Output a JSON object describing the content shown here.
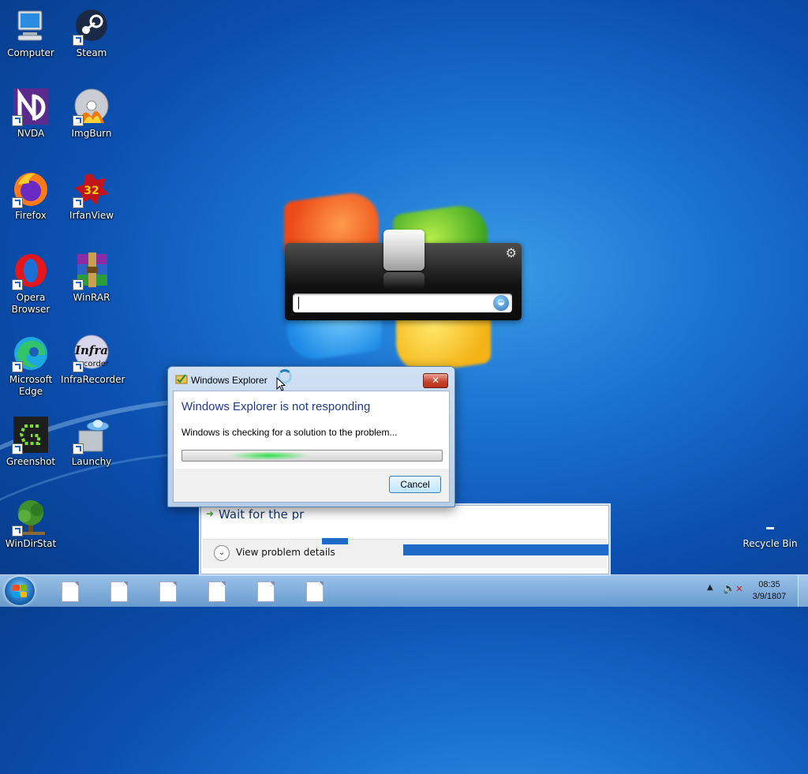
{
  "desktop": {
    "icons": [
      {
        "label": "Computer",
        "icon": "computer-icon"
      },
      {
        "label": "Steam",
        "icon": "steam-icon"
      },
      {
        "label": "NVDA",
        "icon": "nvda-icon"
      },
      {
        "label": "ImgBurn",
        "icon": "imgburn-icon"
      },
      {
        "label": "Firefox",
        "icon": "firefox-icon"
      },
      {
        "label": "IrfanView",
        "icon": "irfanview-icon",
        "badge": "32"
      },
      {
        "label": "Opera Browser",
        "icon": "opera-icon"
      },
      {
        "label": "WinRAR",
        "icon": "winrar-icon"
      },
      {
        "label": "Microsoft Edge",
        "icon": "edge-icon"
      },
      {
        "label": "InfraRecorder",
        "icon": "infrarecorder-icon",
        "art_text": "Infra",
        "art_subtext": "corder"
      },
      {
        "label": "Greenshot",
        "icon": "greenshot-icon"
      },
      {
        "label": "Launchy",
        "icon": "launchy-icon"
      },
      {
        "label": "WinDirStat",
        "icon": "windirstat-icon"
      }
    ],
    "recycle_bin": {
      "label": "Recycle Bin",
      "icon": "recycle-bin-icon"
    }
  },
  "launchy": {
    "settings_icon": "gear-icon",
    "input_value": "",
    "result_icon": "launchy-icon"
  },
  "dialog": {
    "title": "Windows Explorer",
    "close_label": "✕",
    "heading": "Windows Explorer is not responding",
    "message": "Windows is checking for a solution to the problem...",
    "progress_state": "indeterminate",
    "cancel_label": "Cancel"
  },
  "background_dialog": {
    "option_text": "Wait for the pr",
    "details_label": "View problem details"
  },
  "taskbar": {
    "items_count_icon": "document-icon",
    "tray": {
      "volume_icon": "volume-muted-icon",
      "time": "08:35",
      "date": "3/9/1807"
    }
  },
  "colors": {
    "accent_heading": "#1f3a8f",
    "close_red": "#c8452e",
    "progress_green": "#2ee04a"
  }
}
